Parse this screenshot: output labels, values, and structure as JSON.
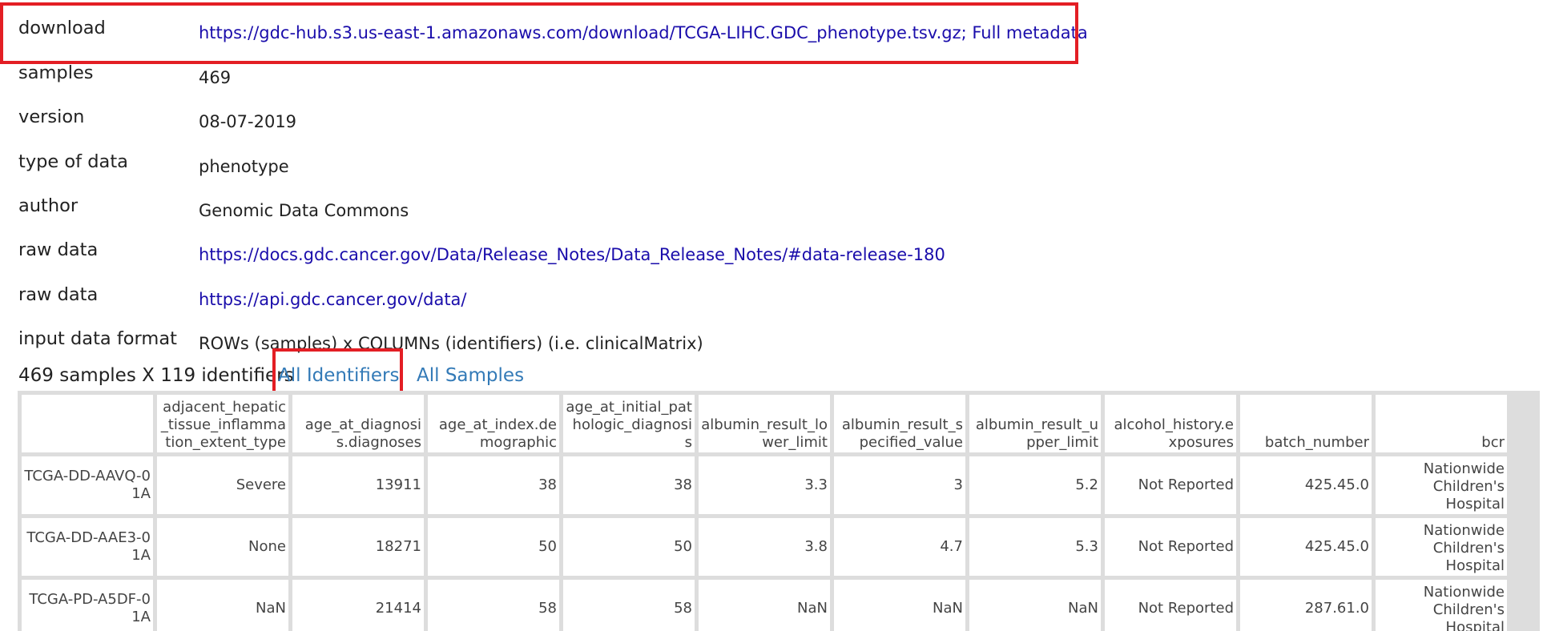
{
  "metadata": [
    {
      "key": "download",
      "value": "https://gdc-hub.s3.us-east-1.amazonaws.com/download/TCGA-LIHC.GDC_phenotype.tsv.gz; Full metadata",
      "is_link": true
    },
    {
      "key": "samples",
      "value": "469",
      "is_link": false
    },
    {
      "key": "version",
      "value": "08-07-2019",
      "is_link": false
    },
    {
      "key": "type of data",
      "value": "phenotype",
      "is_link": false
    },
    {
      "key": "author",
      "value": "Genomic Data Commons",
      "is_link": false
    },
    {
      "key": "raw data",
      "value": "https://docs.gdc.cancer.gov/Data/Release_Notes/Data_Release_Notes/#data-release-180",
      "is_link": true
    },
    {
      "key": "raw data",
      "value": "https://api.gdc.cancer.gov/data/",
      "is_link": true
    },
    {
      "key": "input data format",
      "value": "ROWs (samples) x COLUMNs (identifiers) (i.e. clinicalMatrix)",
      "is_link": false
    }
  ],
  "summary": "469 samples X 119 identifiers",
  "links": {
    "identifiers": "All Identifiers",
    "samples": "All Samples"
  },
  "table": {
    "headers": [
      "",
      "adjacent_hepatic_tissue_inflammation_extent_type",
      "age_at_diagnosis.diagnoses",
      "age_at_index.demographic",
      "age_at_initial_pathologic_diagnosis",
      "albumin_result_lower_limit",
      "albumin_result_specified_value",
      "albumin_result_upper_limit",
      "alcohol_history.exposures",
      "batch_number",
      "bcr"
    ],
    "rows": [
      [
        "TCGA-DD-AAVQ-01A",
        "Severe",
        "13911",
        "38",
        "38",
        "3.3",
        "3",
        "5.2",
        "Not Reported",
        "425.45.0",
        "Nationwide Children's Hospital"
      ],
      [
        "TCGA-DD-AAE3-01A",
        "None",
        "18271",
        "50",
        "50",
        "3.8",
        "4.7",
        "5.3",
        "Not Reported",
        "425.45.0",
        "Nationwide Children's Hospital"
      ],
      [
        "TCGA-PD-A5DF-01A",
        "NaN",
        "21414",
        "58",
        "58",
        "NaN",
        "NaN",
        "NaN",
        "Not Reported",
        "287.61.0",
        "Nationwide Children's Hospital"
      ]
    ]
  },
  "colors": {
    "link": "#1a0dab",
    "tablink": "#337ab7",
    "highlight": "#e31e24",
    "table_border": "#dddddd"
  }
}
